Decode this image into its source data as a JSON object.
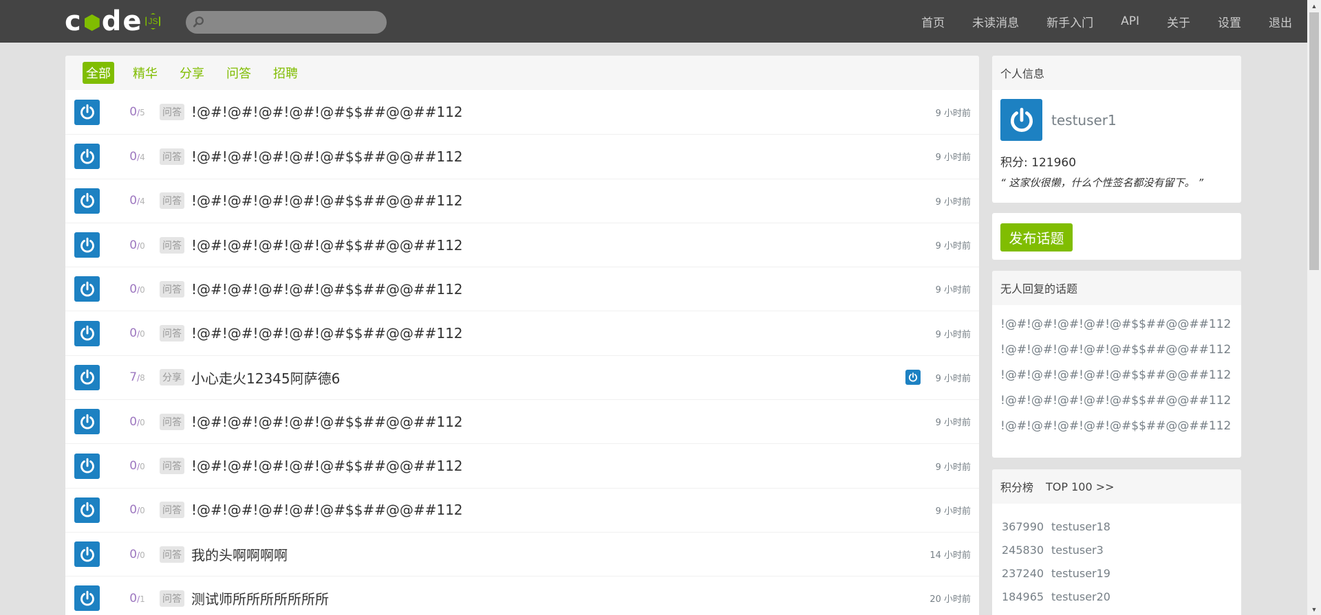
{
  "navbar": {
    "logo_text": "cnode",
    "logo_badge": "JS",
    "search_placeholder": "",
    "links": [
      "首页",
      "未读消息",
      "新手入门",
      "API",
      "关于",
      "设置",
      "退出"
    ]
  },
  "tabs": [
    "全部",
    "精华",
    "分享",
    "问答",
    "招聘"
  ],
  "active_tab": "全部",
  "topics": [
    {
      "replies": "0",
      "visits": "5",
      "tag": "问答",
      "title": "!@#!@#!@#!@#!@#$$##@@##112",
      "time": "9 小时前",
      "last_reply_avatar": false
    },
    {
      "replies": "0",
      "visits": "4",
      "tag": "问答",
      "title": "!@#!@#!@#!@#!@#$$##@@##112",
      "time": "9 小时前",
      "last_reply_avatar": false
    },
    {
      "replies": "0",
      "visits": "4",
      "tag": "问答",
      "title": "!@#!@#!@#!@#!@#$$##@@##112",
      "time": "9 小时前",
      "last_reply_avatar": false
    },
    {
      "replies": "0",
      "visits": "0",
      "tag": "问答",
      "title": "!@#!@#!@#!@#!@#$$##@@##112",
      "time": "9 小时前",
      "last_reply_avatar": false
    },
    {
      "replies": "0",
      "visits": "0",
      "tag": "问答",
      "title": "!@#!@#!@#!@#!@#$$##@@##112",
      "time": "9 小时前",
      "last_reply_avatar": false
    },
    {
      "replies": "0",
      "visits": "0",
      "tag": "问答",
      "title": "!@#!@#!@#!@#!@#$$##@@##112",
      "time": "9 小时前",
      "last_reply_avatar": false
    },
    {
      "replies": "7",
      "visits": "8",
      "tag": "分享",
      "title": "小心走火12345阿萨德6",
      "time": "9 小时前",
      "last_reply_avatar": true
    },
    {
      "replies": "0",
      "visits": "0",
      "tag": "问答",
      "title": "!@#!@#!@#!@#!@#$$##@@##112",
      "time": "9 小时前",
      "last_reply_avatar": false
    },
    {
      "replies": "0",
      "visits": "0",
      "tag": "问答",
      "title": "!@#!@#!@#!@#!@#$$##@@##112",
      "time": "9 小时前",
      "last_reply_avatar": false
    },
    {
      "replies": "0",
      "visits": "0",
      "tag": "问答",
      "title": "!@#!@#!@#!@#!@#$$##@@##112",
      "time": "9 小时前",
      "last_reply_avatar": false
    },
    {
      "replies": "0",
      "visits": "0",
      "tag": "问答",
      "title": "我的头啊啊啊啊",
      "time": "14 小时前",
      "last_reply_avatar": false
    },
    {
      "replies": "0",
      "visits": "1",
      "tag": "问答",
      "title": "测试师所所所所所所所",
      "time": "20 小时前",
      "last_reply_avatar": false
    }
  ],
  "user_panel": {
    "header": "个人信息",
    "username": "testuser1",
    "score": "积分: 121960",
    "signature": "“ 这家伙很懒，什么个性签名都没有留下。 ”"
  },
  "create_button": "发布话题",
  "no_reply_panel": {
    "header": "无人回复的话题",
    "items": [
      "!@#!@#!@#!@#!@#$$##@@##112",
      "!@#!@#!@#!@#!@#$$##@@##112",
      "!@#!@#!@#!@#!@#$$##@@##112",
      "!@#!@#!@#!@#!@#$$##@@##112",
      "!@#!@#!@#!@#!@#$$##@@##112"
    ]
  },
  "rank_panel": {
    "header": "积分榜",
    "link": "TOP 100 >>",
    "items": [
      {
        "score": "367990",
        "name": "testuser18"
      },
      {
        "score": "245830",
        "name": "testuser3"
      },
      {
        "score": "237240",
        "name": "testuser19"
      },
      {
        "score": "184965",
        "name": "testuser20"
      }
    ]
  },
  "colors": {
    "navbar_bg": "#444444",
    "accent_green": "#80bd01",
    "avatar_blue": "#1d81c2",
    "reply_purple": "#9e78c0",
    "page_bg": "#e1e1e1"
  },
  "icons": {
    "search": "search-icon",
    "avatar": "power-icon",
    "scroll_up": "triangle-up",
    "scroll_down": "triangle-down"
  }
}
